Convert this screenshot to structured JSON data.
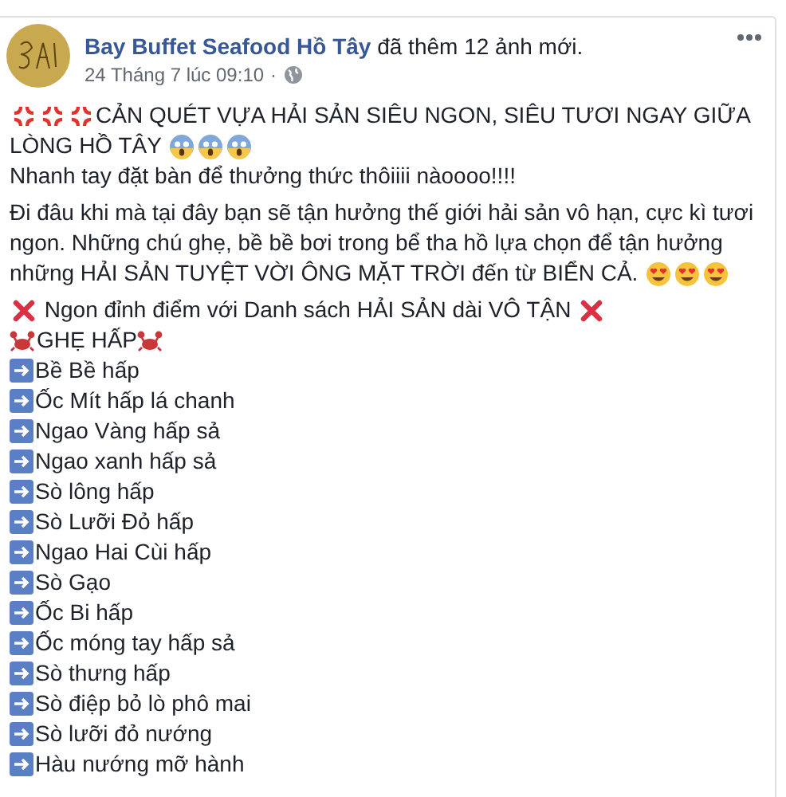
{
  "post": {
    "author": "Bay Buffet Seafood Hồ Tây",
    "action": "đã thêm 12 ảnh mới.",
    "time": "24 Tháng 7 lúc 09:10",
    "separator": "·",
    "headline_lines": [
      "CẢN QUÉT VỰA HẢI SẢN SIÊU NGON, SIÊU TƯƠI NGAY GIỮA",
      "LÒNG HỒ TÂY"
    ],
    "tagline": "Nhanh tay đặt bàn để thưởng thức thôiiii nàoooo!!!!",
    "body_lines": [
      "Đi đâu khi mà tại đây bạn sẽ tận hưởng thế giới hải sản vô hạn, cực kì tươi",
      "ngon. Những chú ghẹ, bề bề bơi trong bể tha hồ lựa chọn để tận hưởng",
      "những HẢI SẢN TUYỆT VỜI ÔNG MẶT TRỜI đến từ BIỂN CẢ."
    ],
    "banner": "Ngon đỉnh điểm với Danh sách HẢI SẢN dài VÔ TẬN",
    "list_title": "GHẸ HẤP",
    "items": [
      "Bề Bề hấp",
      "Ốc Mít hấp lá chanh",
      "Ngao Vàng hấp sả",
      "Ngao xanh hấp sả",
      "Sò lông hấp",
      "Sò Lưỡi Đỏ hấp",
      "Ngao Hai Cùi hấp",
      "Sò Gạo",
      "Ốc Bi hấp",
      "Ốc móng tay hấp sả",
      "Sò thưng hấp",
      "Sò điệp bỏ lò phô mai",
      "Sò lưỡi đỏ nướng",
      "Hàu nướng mỡ hành"
    ]
  }
}
